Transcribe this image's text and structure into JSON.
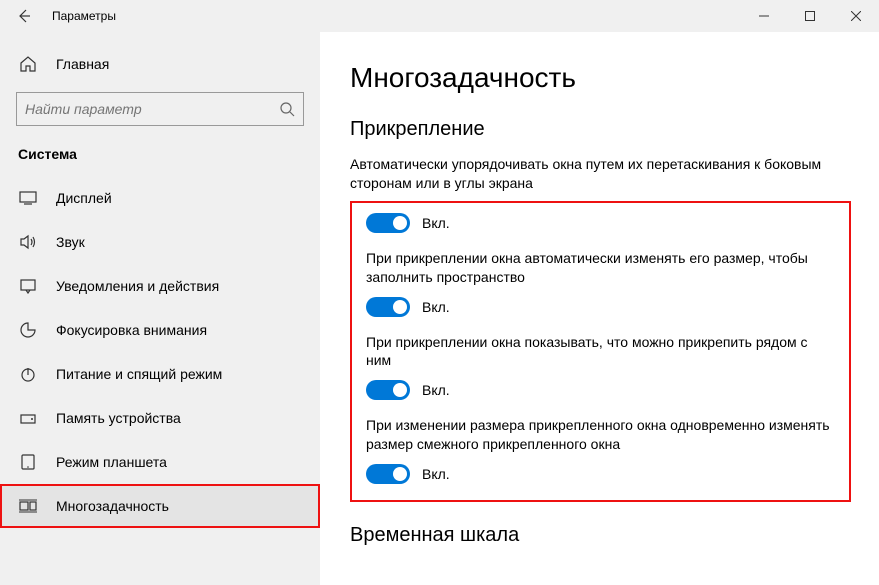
{
  "titlebar": {
    "title": "Параметры"
  },
  "sidebar": {
    "home_label": "Главная",
    "search_placeholder": "Найти параметр",
    "category": "Система",
    "items": [
      {
        "label": "Дисплей"
      },
      {
        "label": "Звук"
      },
      {
        "label": "Уведомления и действия"
      },
      {
        "label": "Фокусировка внимания"
      },
      {
        "label": "Питание и спящий режим"
      },
      {
        "label": "Память устройства"
      },
      {
        "label": "Режим планшета"
      },
      {
        "label": "Многозадачность"
      }
    ]
  },
  "main": {
    "heading": "Многозадачность",
    "section1_title": "Прикрепление",
    "snap_intro": "Автоматически упорядочивать окна путем их перетаскивания к боковым сторонам или в углы экрана",
    "toggles": [
      {
        "desc": "",
        "state": "Вкл."
      },
      {
        "desc": "При прикреплении окна автоматически изменять его размер, чтобы заполнить пространство",
        "state": "Вкл."
      },
      {
        "desc": "При прикреплении окна показывать, что можно прикрепить рядом с ним",
        "state": "Вкл."
      },
      {
        "desc": "При изменении размера прикрепленного окна одновременно изменять размер смежного прикрепленного окна",
        "state": "Вкл."
      }
    ],
    "section2_title": "Временная шкала"
  }
}
